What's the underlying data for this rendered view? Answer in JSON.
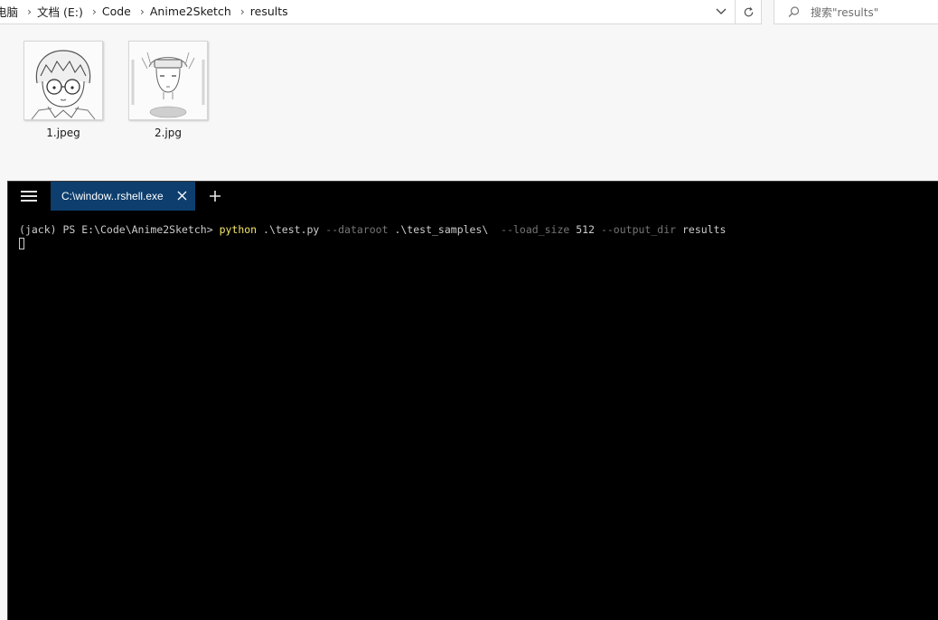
{
  "explorer": {
    "breadcrumb": [
      "电脑",
      "文档 (E:)",
      "Code",
      "Anime2Sketch",
      "results"
    ],
    "search_placeholder": "搜索\"results\"",
    "files": [
      {
        "name": "1.jpeg",
        "icon": "sketch-thumbnail-conan"
      },
      {
        "name": "2.jpg",
        "icon": "sketch-thumbnail-naruto"
      }
    ]
  },
  "terminal": {
    "tab_title": "C:\\window..rshell.exe",
    "prompt": "(jack) PS E:\\Code\\Anime2Sketch> ",
    "command": "python",
    "arg1": " .\\test.py ",
    "flag1": "--dataroot",
    "val1": " .\\test_samples\\  ",
    "flag2": "--load_size",
    "val2": " 512 ",
    "flag3": "--output_dir",
    "val3": " results"
  },
  "colors": {
    "terminal_bg": "#000000",
    "tab_active": "#0d3e6e",
    "command": "#f4e66b",
    "parameter": "#767676",
    "text": "#cccccc"
  }
}
